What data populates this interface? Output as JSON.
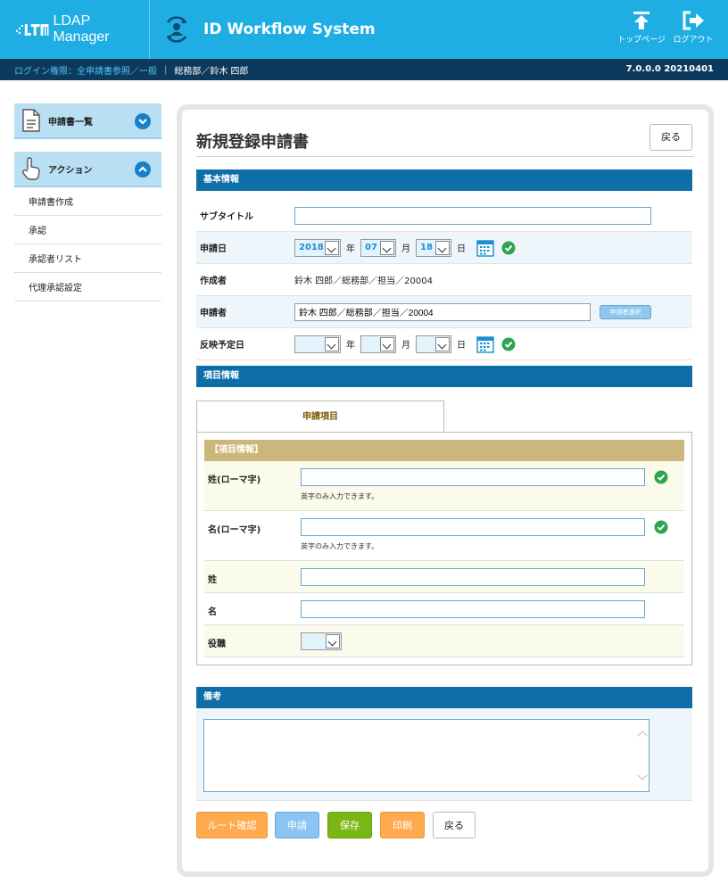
{
  "header": {
    "brand": "LDAP Manager",
    "system_title": "ID Workflow System",
    "top_page": "トップページ",
    "logout": "ログアウト"
  },
  "subbar": {
    "permission": "ログイン権限：全申請書参照／一般",
    "user": "総務部／鈴木 四郎",
    "version": "7.0.0.0 20210401"
  },
  "sidebar": {
    "list_header": "申請書一覧",
    "action_header": "アクション",
    "items": [
      "申請書作成",
      "承認",
      "承認者リスト",
      "代理承認設定"
    ]
  },
  "main": {
    "title": "新規登録申請書",
    "back_label": "戻る",
    "basic_section": "基本情報",
    "fields": {
      "subtitle_label": "サブタイトル",
      "subtitle_value": "",
      "apply_date_label": "申請日",
      "apply_year": "2018",
      "apply_month": "07",
      "apply_day": "18",
      "year_unit": "年",
      "month_unit": "月",
      "day_unit": "日",
      "author_label": "作成者",
      "author_value": "鈴木 四郎／総務部／担当／20004",
      "applicant_label": "申請者",
      "applicant_value": "鈴木 四郎／総務部／担当／20004",
      "applicant_select": "申請者選択",
      "reflect_date_label": "反映予定日",
      "reflect_year": "",
      "reflect_month": "",
      "reflect_day": ""
    },
    "item_section": "項目情報",
    "tab_label": "申請項目",
    "item_box_header": "【項目情報】",
    "items": {
      "last_roman_label": "姓(ローマ字)",
      "last_roman_hint": "英字のみ入力できます。",
      "first_roman_label": "名(ローマ字)",
      "first_roman_hint": "英字のみ入力できます。",
      "last_label": "姓",
      "first_label": "名",
      "position_label": "役職",
      "position_value": ""
    },
    "remarks_section": "備考",
    "remarks_value": "",
    "actions": {
      "route": "ルート確認",
      "apply": "申請",
      "save": "保存",
      "print": "印刷",
      "back": "戻る"
    }
  },
  "colors": {
    "header": "#1eaee3",
    "subbar": "#0d3a5c",
    "section": "#0e6fa8",
    "gold": "#cbb77c"
  },
  "icons": [
    "ltm-logo-icon",
    "workflow-icon",
    "top-page-icon",
    "logout-icon",
    "document-icon",
    "hand-icon",
    "chevron-down-icon",
    "chevron-up-icon",
    "calendar-icon",
    "check-circle-icon"
  ]
}
